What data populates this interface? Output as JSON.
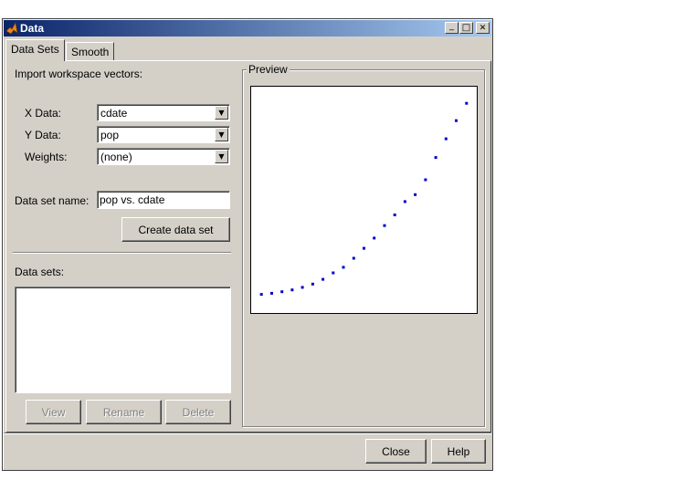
{
  "window": {
    "title": "Data",
    "minimize_glyph": "_",
    "maximize_glyph": "□",
    "close_glyph": "✕"
  },
  "tabs": [
    {
      "label": "Data Sets",
      "selected": true
    },
    {
      "label": "Smooth",
      "selected": false
    }
  ],
  "import": {
    "heading": "Import workspace vectors:",
    "x_label": "X Data:",
    "x_value": "cdate",
    "y_label": "Y Data:",
    "y_value": "pop",
    "weights_label": "Weights:",
    "weights_value": "(none)",
    "dataset_name_label": "Data set name:",
    "dataset_name_value": "pop vs. cdate",
    "create_button": "Create data set"
  },
  "datasets": {
    "heading": "Data sets:",
    "items": [],
    "view_button": "View",
    "rename_button": "Rename",
    "delete_button": "Delete"
  },
  "preview": {
    "heading": "Preview"
  },
  "footer": {
    "close_button": "Close",
    "help_button": "Help"
  },
  "colors": {
    "marker": "#0000cc"
  },
  "chart_data": {
    "type": "scatter",
    "x": [
      1790,
      1800,
      1810,
      1820,
      1830,
      1840,
      1850,
      1860,
      1870,
      1880,
      1890,
      1900,
      1910,
      1920,
      1930,
      1940,
      1950,
      1960,
      1970,
      1980,
      1990
    ],
    "y": [
      3.9,
      5.3,
      7.2,
      9.6,
      12.9,
      17.1,
      23.1,
      31.4,
      38.6,
      50.2,
      62.9,
      76.0,
      92.0,
      105.7,
      122.8,
      131.7,
      150.7,
      179.3,
      203.2,
      226.5,
      248.7
    ],
    "xlim": [
      1780,
      2000
    ],
    "ylim": [
      -20,
      270
    ],
    "grid": false
  }
}
